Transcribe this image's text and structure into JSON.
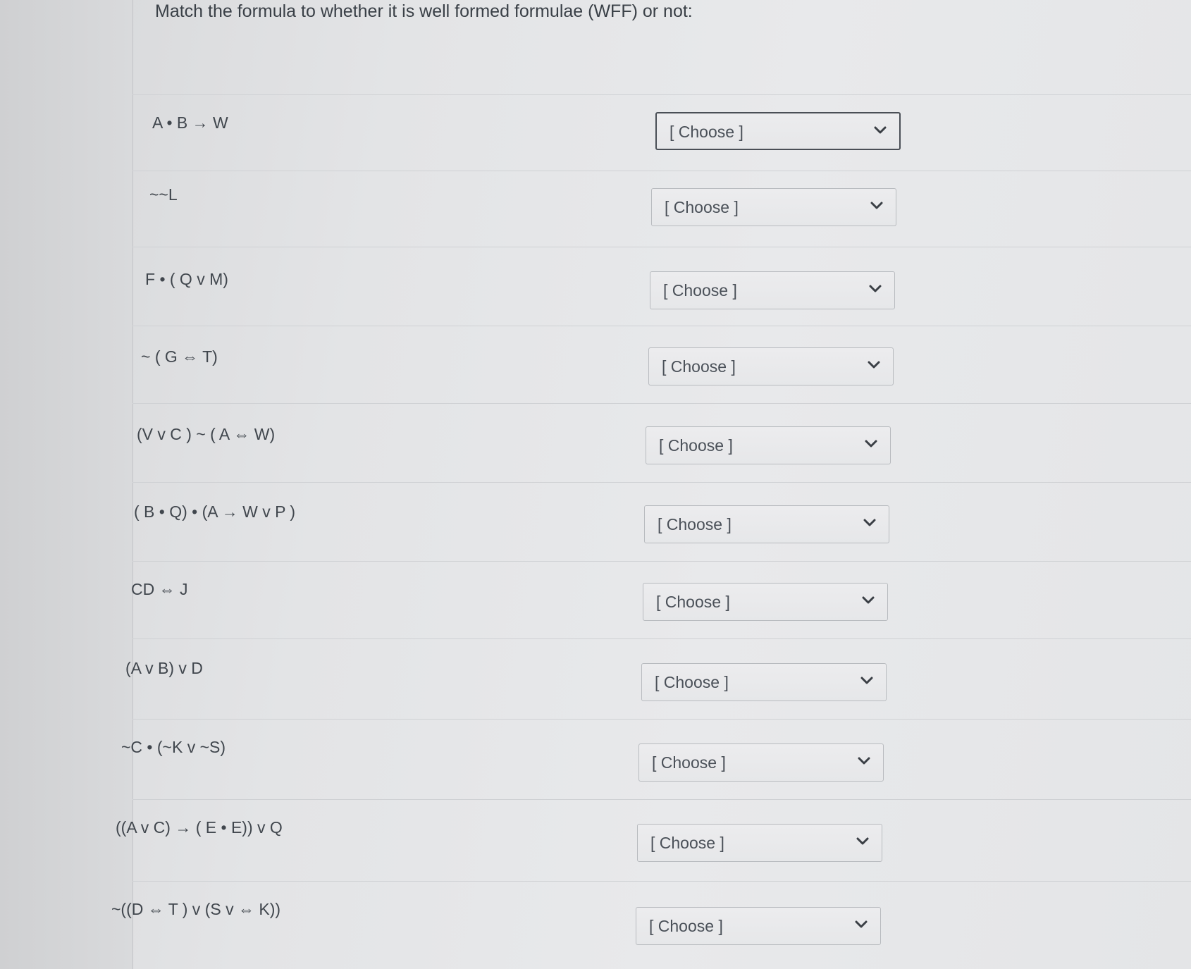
{
  "question": {
    "title": "Match the formula to whether it is well formed formulae (WFF) or not:"
  },
  "select_placeholder": "[ Choose ]",
  "icons": {
    "dropdown": "chevron-down-icon"
  },
  "rows": [
    {
      "formula": "A • B → W",
      "selected": "[ Choose ]"
    },
    {
      "formula": "~~L",
      "selected": "[ Choose ]"
    },
    {
      "formula": "F • ( Q v M)",
      "selected": "[ Choose ]"
    },
    {
      "formula": "~ ( G ⇔ T)",
      "selected": "[ Choose ]"
    },
    {
      "formula": "(V v C ) ~ ( A ⇔ W)",
      "selected": "[ Choose ]"
    },
    {
      "formula": "( B • Q) • (A → W v P )",
      "selected": "[ Choose ]"
    },
    {
      "formula": "CD ⇔ J",
      "selected": "[ Choose ]"
    },
    {
      "formula": "(A v B) v D",
      "selected": "[ Choose ]"
    },
    {
      "formula": "~C • (~K v ~S)",
      "selected": "[ Choose ]"
    },
    {
      "formula": "((A v C) → ( E • E)) v Q",
      "selected": "[ Choose ]"
    },
    {
      "formula": "~((D ⇔ T ) v (S v ⇔ K))",
      "selected": "[ Choose ]"
    }
  ]
}
